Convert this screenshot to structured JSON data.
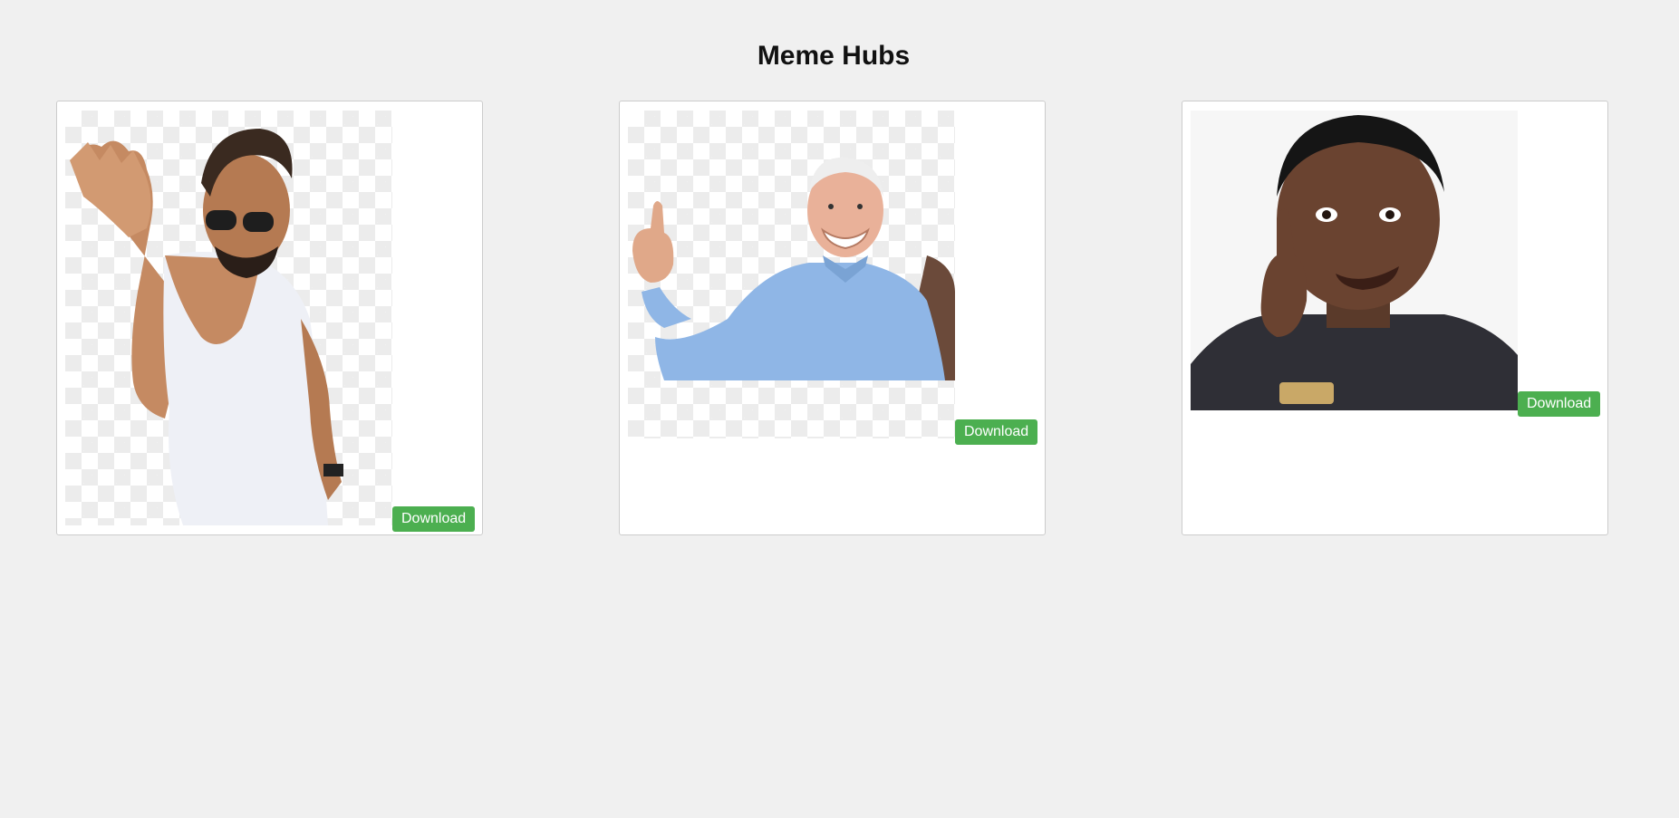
{
  "header": {
    "title": "Meme Hubs"
  },
  "memes": [
    {
      "download_label": "Download",
      "image": "salt-bae-meme"
    },
    {
      "download_label": "Download",
      "image": "hide-the-pain-harold-meme"
    },
    {
      "download_label": "Download",
      "image": "roll-safe-meme"
    }
  ],
  "colors": {
    "page_background": "#f0f0f0",
    "card_background": "#ffffff",
    "card_border": "#cccccc",
    "button_background": "#4caf50",
    "button_text": "#ffffff"
  }
}
